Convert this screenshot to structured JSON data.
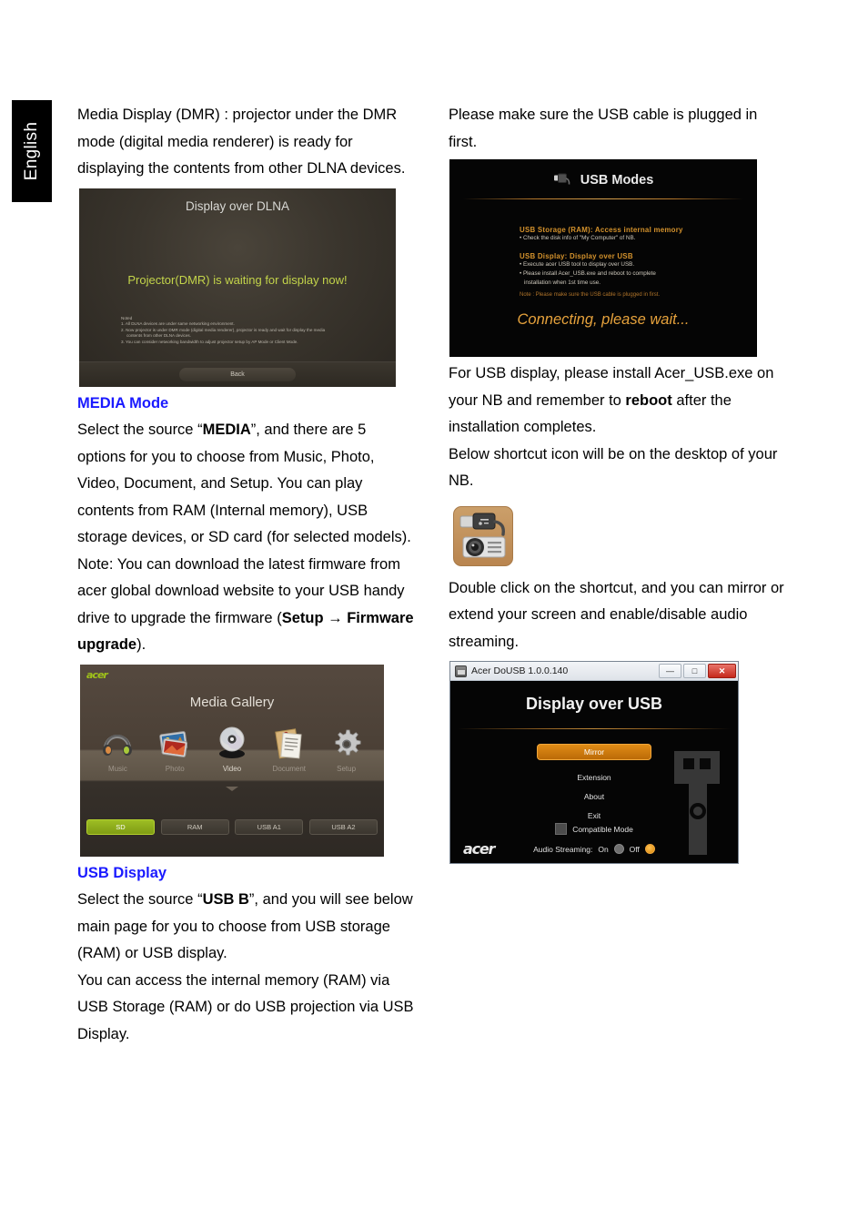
{
  "page": {
    "language_tab": "English"
  },
  "left_column": {
    "intro_paragraph": "Media Display (DMR) : projector under the DMR mode (digital media renderer) is ready for displaying the contents from other DLNA devices.",
    "dlna_screenshot": {
      "name": "display-over-dlna-screen",
      "title": "Display over DLNA",
      "status": "Projector(DMR) is waiting for display now!",
      "notes_heading": "Noted",
      "notes": [
        "1. All DLNA devices are under same networking environment.",
        "2. Now projector is under DMR mode (digital media renderer), projector is ready and wait for display the media",
        "contents from other DLNA devices.",
        "3. You can consider networking bandwidth to adjust projector setup by AP  Mode or Client Mode."
      ],
      "back_button": "Back"
    },
    "media_mode": {
      "heading": "MEDIA Mode",
      "paragraph_prefix": "Select the source “",
      "paragraph_bold": "MEDIA",
      "paragraph_rest": "”, and there are 5 options for you to choose from Music, Photo, Video, Document, and Setup. You can play contents from RAM (Internal memory), USB storage devices, or SD card (for selected models).",
      "note_prefix": "Note: You can download the latest firmware from acer global download website to your USB handy drive to upgrade the firmware (",
      "note_bold_1": "Setup →",
      "note_bold_2": "Firmware upgrade",
      "note_suffix": ")."
    },
    "gallery_screenshot": {
      "name": "media-gallery-screen",
      "brand": "acer",
      "title": "Media Gallery",
      "icons": [
        {
          "label": "Music",
          "icon": "headphones-icon",
          "active": false
        },
        {
          "label": "Photo",
          "icon": "photo-icon",
          "active": false
        },
        {
          "label": "Video",
          "icon": "disc-icon",
          "active": true
        },
        {
          "label": "Document",
          "icon": "document-icon",
          "active": false
        },
        {
          "label": "Setup",
          "icon": "gear-icon",
          "active": false
        }
      ],
      "sources": [
        {
          "label": "SD",
          "selected": true
        },
        {
          "label": "RAM",
          "selected": false
        },
        {
          "label": "USB A1",
          "selected": false
        },
        {
          "label": "USB A2",
          "selected": false
        }
      ],
      "selected_color": "#8fae1c"
    },
    "usb_display": {
      "heading": "USB Display",
      "paragraph_prefix": "Select the source “",
      "paragraph_bold": "USB B",
      "paragraph_rest": "”, and you will see below main page for you to choose from USB storage (RAM) or USB display.",
      "paragraph_2": "You can access the internal memory (RAM) via USB Storage (RAM) or do USB projection via USB Display."
    }
  },
  "right_column": {
    "cable_note": "Please make sure the USB cable is plugged in first.",
    "usb_modes_screenshot": {
      "name": "usb-modes-screen",
      "heading": "USB Modes",
      "heading_icon": "usb-connector-icon",
      "section_1_title": "USB Storage (RAM): Access internal memory",
      "section_1_bullets": [
        "• Check the disk info of \"My Computer\" of NB."
      ],
      "section_2_title": "USB Display: Display over USB",
      "section_2_bullets": [
        "• Execute acer USB tool to display over USB.",
        "• Please install Acer_USB.exe and reboot to complete",
        "installation when 1st time use."
      ],
      "note": "Note : Please make sure the USB cable is plugged in first.",
      "status": "Connecting, please wait...",
      "accent_color": "#d4922c"
    },
    "install_paragraph_1_a": "For USB display, please install Acer_USB.exe on your NB and remember to ",
    "install_paragraph_1_bold": "reboot",
    "install_paragraph_1_b": " after the installation completes.",
    "install_paragraph_2": "Below shortcut icon will be on the desktop of your NB.",
    "shortcut_icon": {
      "name": "acer-dousb-desktop-shortcut-icon",
      "depicts": "usb-plug-and-projector-icon",
      "background_color": "#c1904f"
    },
    "double_click_paragraph": "Double click on the shortcut, and you can mirror or extend your screen and enable/disable audio streaming.",
    "dousb_window": {
      "name": "acer-dousb-window",
      "title": "Acer DoUSB 1.0.0.140",
      "minimize_label": "—",
      "maximize_label": "□",
      "close_label": "✕",
      "screen_title": "Display over USB",
      "menu": [
        {
          "label": "Mirror",
          "primary": true
        },
        {
          "label": "Extension",
          "primary": false
        },
        {
          "label": "About",
          "primary": false
        },
        {
          "label": "Exit",
          "primary": false
        }
      ],
      "compatible_mode_label": "Compatible Mode",
      "compatible_mode_checked": false,
      "audio_streaming_label": "Audio Streaming:",
      "audio_on_label": "On",
      "audio_off_label": "Off",
      "audio_selected": "Off",
      "brand": "acer",
      "accent_color": "#d8860c"
    }
  }
}
